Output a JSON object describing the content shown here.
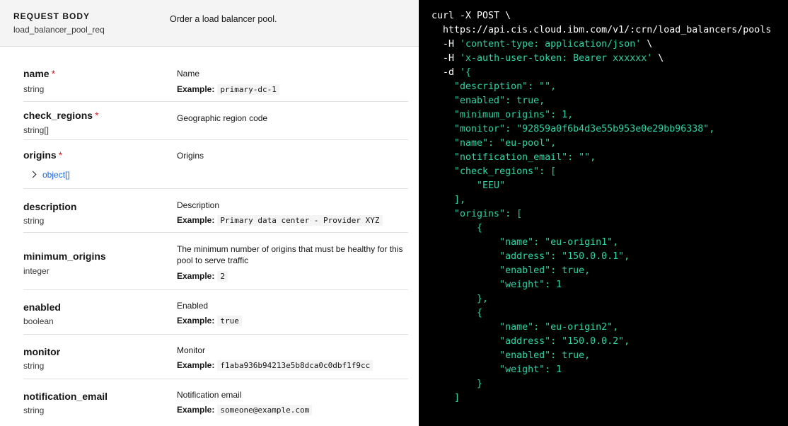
{
  "request_body": {
    "title": "REQUEST BODY",
    "ref": "load_balancer_pool_req",
    "description": "Order a load balancer pool."
  },
  "properties": [
    {
      "name": "name",
      "required": true,
      "type": "string",
      "description": "Name",
      "example_label": "Example:",
      "example": "primary-dc-1"
    },
    {
      "name": "check_regions",
      "required": true,
      "type": "string[]",
      "description": "Geographic region code"
    },
    {
      "name": "origins",
      "required": true,
      "type": "object[]",
      "description": "Origins"
    },
    {
      "name": "description",
      "required": false,
      "type": "string",
      "description": "Description",
      "example_label": "Example:",
      "example": "Primary data center - Provider XYZ"
    },
    {
      "name": "minimum_origins",
      "required": false,
      "type": "integer",
      "description": "The minimum number of origins that must be healthy for this pool to serve traffic",
      "example_label": "Example:",
      "example": "2"
    },
    {
      "name": "enabled",
      "required": false,
      "type": "boolean",
      "description": "Enabled",
      "example_label": "Example:",
      "example": "true"
    },
    {
      "name": "monitor",
      "required": false,
      "type": "string",
      "description": "Monitor",
      "example_label": "Example:",
      "example": "f1aba936b94213e5b8dca0c0dbf1f9cc"
    },
    {
      "name": "notification_email",
      "required": false,
      "type": "string",
      "description": "Notification email",
      "example_label": "Example:",
      "example": "someone@example.com"
    }
  ],
  "code": {
    "l1": "curl -X POST \\",
    "l2": "  https://api.cis.cloud.ibm.com/v1/:crn/load_balancers/pools",
    "l3a": "  -H ",
    "l3b": "'content-type: application/json'",
    "l3c": " \\",
    "l4a": "  -H ",
    "l4b": "'x-auth-user-token: Bearer xxxxxx'",
    "l4c": " \\",
    "l5a": "  -d ",
    "l5b": "'{",
    "body": [
      "    \"description\": \"\",",
      "    \"enabled\": true,",
      "    \"minimum_origins\": 1,",
      "    \"monitor\": \"92859a0f6b4d3e55b953e0e29bb96338\",",
      "    \"name\": \"eu-pool\",",
      "    \"notification_email\": \"\",",
      "    \"check_regions\": [",
      "        \"EEU\"",
      "    ],",
      "    \"origins\": [",
      "        {",
      "            \"name\": \"eu-origin1\",",
      "            \"address\": \"150.0.0.1\",",
      "            \"enabled\": true,",
      "            \"weight\": 1",
      "        },",
      "        {",
      "            \"name\": \"eu-origin2\",",
      "            \"address\": \"150.0.0.2\",",
      "            \"enabled\": true,",
      "            \"weight\": 1",
      "        }",
      "    ]",
      "}'"
    ]
  }
}
